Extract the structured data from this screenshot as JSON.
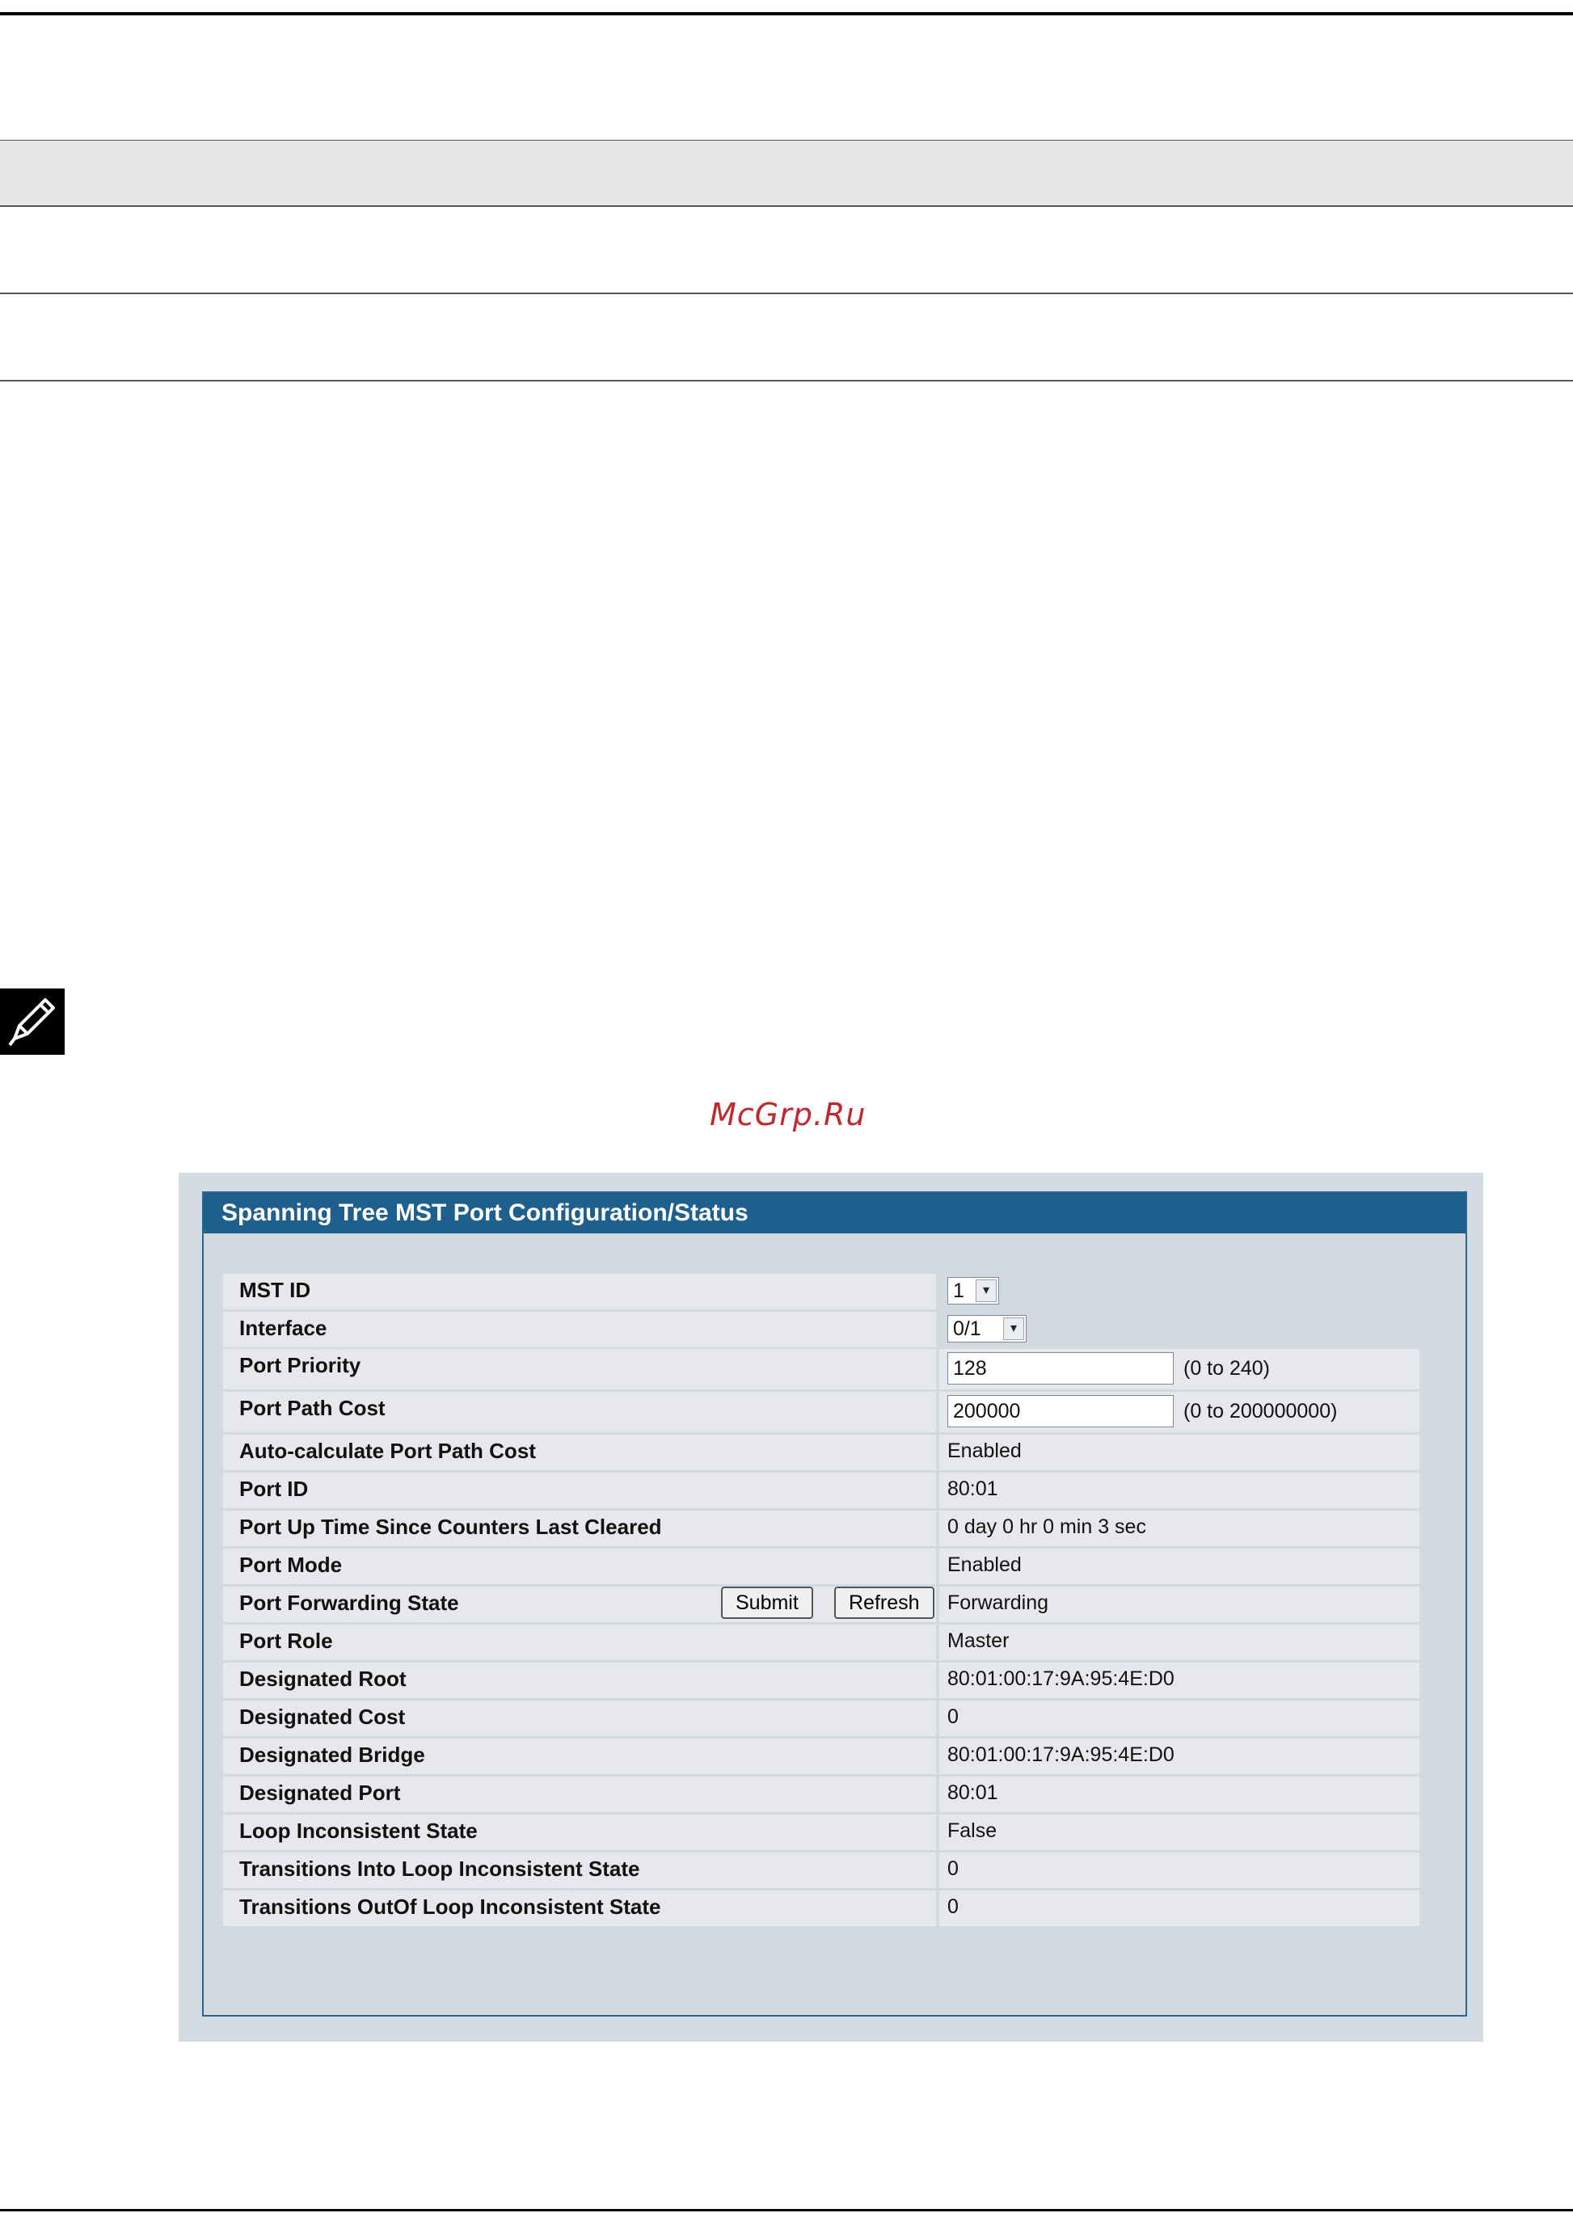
{
  "watermark": "McGrp.Ru",
  "panel": {
    "title": "Spanning Tree MST Port Configuration/Status"
  },
  "rows": [
    {
      "label": "MST ID",
      "type": "select",
      "value": "1"
    },
    {
      "label": "Interface",
      "type": "select",
      "value": "0/1"
    },
    {
      "label": "Port Priority",
      "type": "text",
      "value": "128",
      "hint": "(0 to 240)"
    },
    {
      "label": "Port Path Cost",
      "type": "text",
      "value": "200000",
      "hint": "(0 to 200000000)"
    },
    {
      "label": "Auto-calculate Port Path Cost",
      "value": "Enabled"
    },
    {
      "label": "Port ID",
      "value": "80:01"
    },
    {
      "label": "Port Up Time Since Counters Last Cleared",
      "value": "0 day 0 hr 0 min 3 sec"
    },
    {
      "label": "Port Mode",
      "value": "Enabled"
    },
    {
      "label": "Port Forwarding State",
      "value": "Forwarding"
    },
    {
      "label": "Port Role",
      "value": "Master"
    },
    {
      "label": "Designated Root",
      "value": "80:01:00:17:9A:95:4E:D0"
    },
    {
      "label": "Designated Cost",
      "value": "0"
    },
    {
      "label": "Designated Bridge",
      "value": "80:01:00:17:9A:95:4E:D0"
    },
    {
      "label": "Designated Port",
      "value": "80:01"
    },
    {
      "label": "Loop Inconsistent State",
      "value": "False"
    },
    {
      "label": "Transitions Into Loop Inconsistent State",
      "value": "0"
    },
    {
      "label": "Transitions OutOf Loop Inconsistent State",
      "value": "0"
    }
  ],
  "buttons": {
    "submit": "Submit",
    "refresh": "Refresh"
  },
  "colors": {
    "title_bar": "#1f5f8e",
    "panel_bg": "#d3d9e0",
    "row_bg": "#e6e8ec"
  }
}
